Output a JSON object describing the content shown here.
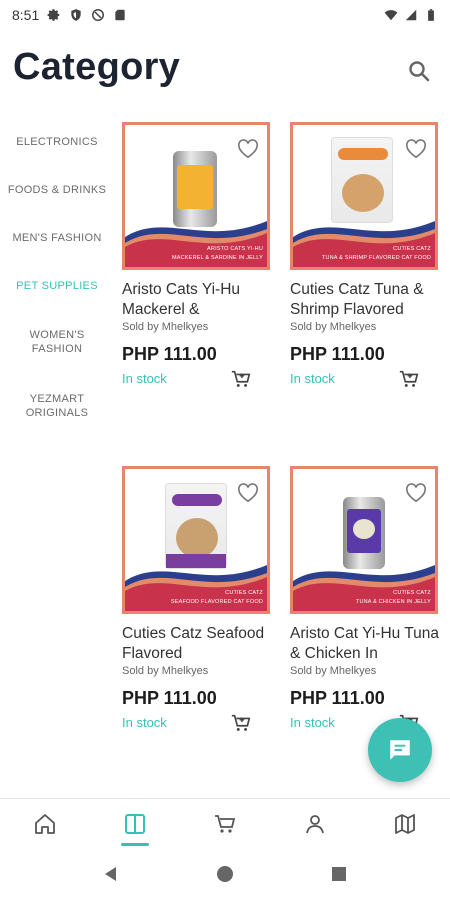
{
  "status_bar": {
    "time": "8:51"
  },
  "header": {
    "title": "Category"
  },
  "sidebar": {
    "items": [
      {
        "label": "ELECTRONICS",
        "active": false
      },
      {
        "label": "FOODS & DRINKS",
        "active": false
      },
      {
        "label": "MEN'S FASHION",
        "active": false
      },
      {
        "label": "PET SUPPLIES",
        "active": true
      },
      {
        "label": "WOMEN'S FASHION",
        "active": false
      },
      {
        "label": "YEZMART ORIGINALS",
        "active": false
      }
    ]
  },
  "products": [
    {
      "name": "Aristo Cats Yi-Hu Mackerel &",
      "seller": "Sold by Mhelkyes",
      "price": "PHP 111.00",
      "stock": "In stock",
      "band_title": "ARISTO CATS YI-HU",
      "band_subtitle": "MACKEREL & SARDINE IN JELLY",
      "package": "can",
      "package_color": "#f3b232"
    },
    {
      "name": "Cuties Catz Tuna & Shrimp Flavored",
      "seller": "Sold by Mhelkyes",
      "price": "PHP 111.00",
      "stock": "In stock",
      "band_title": "CUTIES CATZ",
      "band_subtitle": "TUNA & SHRIMP FLAVORED CAT FOOD",
      "package": "bag",
      "package_color": "#e98b3a"
    },
    {
      "name": "Cuties Catz Seafood Flavored",
      "seller": "Sold by Mhelkyes",
      "price": "PHP 111.00",
      "stock": "In stock",
      "band_title": "CUTIES CATZ",
      "band_subtitle": "SEAFOOD FLAVORED CAT FOOD",
      "package": "bag",
      "package_color": "#7a3ea0"
    },
    {
      "name": "Aristo Cat Yi-Hu Tuna & Chicken In",
      "seller": "Sold by Mhelkyes",
      "price": "PHP 111.00",
      "stock": "In stock",
      "band_title": "CUTIES CATZ",
      "band_subtitle": "TUNA & CHICKEN IN JELLY",
      "package": "can",
      "package_color": "#5a3aa8"
    }
  ],
  "bottom_nav": {
    "items": [
      {
        "icon": "home-icon",
        "active": false
      },
      {
        "icon": "category-icon",
        "active": true
      },
      {
        "icon": "cart-icon",
        "active": false
      },
      {
        "icon": "account-icon",
        "active": false
      },
      {
        "icon": "map-icon",
        "active": false
      }
    ]
  },
  "colors": {
    "accent": "#35c2b6",
    "card_border": "#e7846c",
    "band_red": "#c8324a",
    "band_navy": "#2a3f8e"
  }
}
